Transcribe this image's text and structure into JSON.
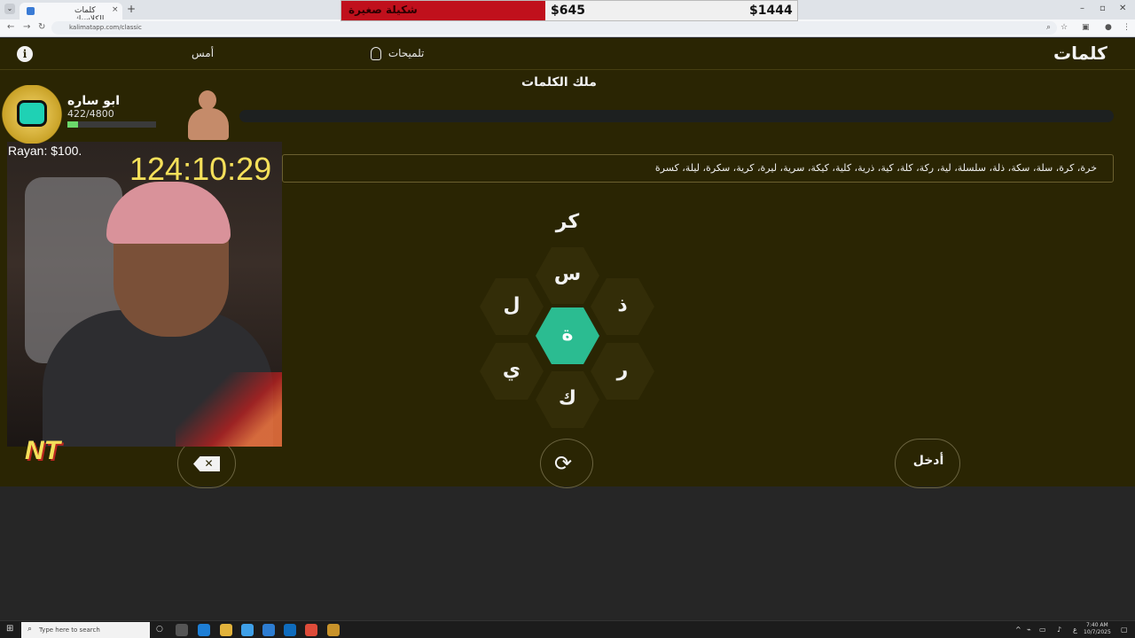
{
  "browser": {
    "tab_title": "كلمات الكلاسيك",
    "url": "kalimatapp.com/classic",
    "new_tab": "+",
    "close_tab": "×"
  },
  "banner": {
    "title": "شكيلة صغيرة",
    "amount_1": "$645",
    "amount_2": "$1444"
  },
  "nav": {
    "logo": "كلمات",
    "hints_label": "تلميحات",
    "yesterday_label": "أمس",
    "info_label": "i"
  },
  "game": {
    "rank_label": "ملك الكلمات",
    "found_words": "خرة، كرة، سلة، سكة، ذلة، سلسلة، لية، ركة، كلة، كية، ذرية، كلية، كيكة، سرية، ليرة، كرية، سكرة، ليلة، كسرة",
    "current_word": "كر",
    "letters": {
      "top": "س",
      "upper_left": "ل",
      "upper_right": "ذ",
      "center": "ة",
      "lower_left": "ي",
      "lower_right": "ر",
      "bottom": "ك"
    },
    "enter_label": "أدخل",
    "delete_label": "✕",
    "shuffle_label": "⟳"
  },
  "stream": {
    "timer": "124:10:29",
    "donor": "Rayan: $100.",
    "user_name": "ابو ساره",
    "user_count": "422/4800",
    "user_progress": 0.12,
    "logo_text": "NT"
  },
  "taskbar": {
    "search_placeholder": "Type here to search",
    "time": "7:40 AM",
    "date": "10/7/2025",
    "lang": "ع"
  },
  "colors": {
    "page_bg": "#2a2503",
    "hex_bg": "#332d08",
    "accent": "#2bbc91",
    "banner_red": "#c0101c",
    "timer": "#f5e05a"
  }
}
